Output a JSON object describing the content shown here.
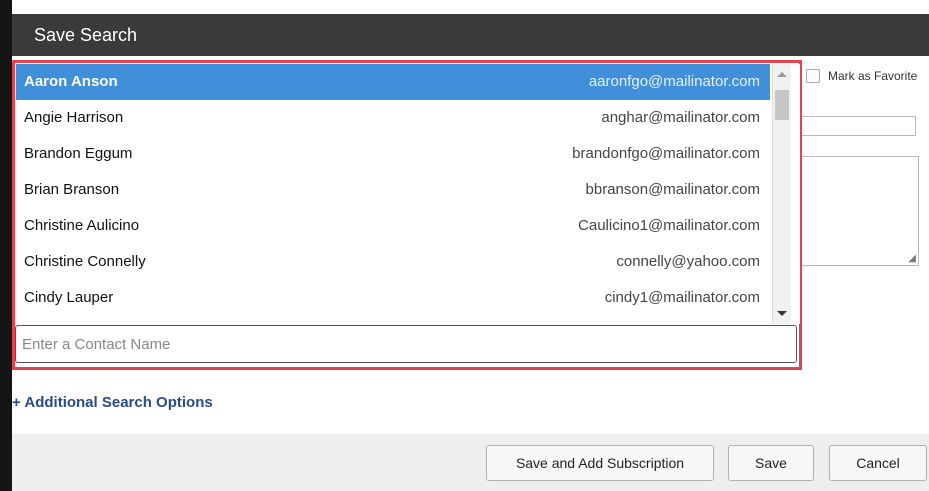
{
  "dialog": {
    "title": "Save Search"
  },
  "favorite": {
    "label": "Mark as Favorite",
    "checked": false
  },
  "contacts": [
    {
      "name": "Aaron Anson",
      "email": "aaronfgo@mailinator.com",
      "selected": true
    },
    {
      "name": "Angie Harrison",
      "email": "anghar@mailinator.com",
      "selected": false
    },
    {
      "name": "Brandon Eggum",
      "email": "brandonfgo@mailinator.com",
      "selected": false
    },
    {
      "name": "Brian Branson",
      "email": "bbranson@mailinator.com",
      "selected": false
    },
    {
      "name": "Christine Aulicino",
      "email": "Caulicino1@mailinator.com",
      "selected": false
    },
    {
      "name": "Christine Connelly",
      "email": "connelly@yahoo.com",
      "selected": false
    },
    {
      "name": "Cindy Lauper",
      "email": "cindy1@mailinator.com",
      "selected": false
    }
  ],
  "contact_input": {
    "placeholder": "Enter a Contact Name",
    "value": ""
  },
  "additional_options": {
    "label": "+ Additional Search Options"
  },
  "buttons": {
    "save_and_subscribe": "Save and Add Subscription",
    "save": "Save",
    "cancel": "Cancel"
  },
  "colors": {
    "highlight": "#e8434b",
    "selected_row": "#3f8fdb",
    "link": "#2b4a88"
  }
}
